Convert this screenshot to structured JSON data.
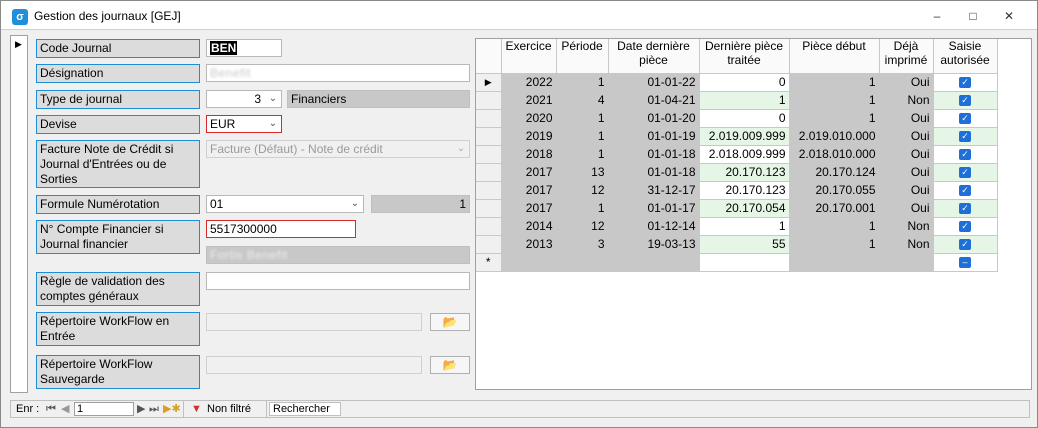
{
  "window": {
    "title": "Gestion des journaux [GEJ]",
    "min": "–",
    "max": "□",
    "close": "✕",
    "icon": "σ"
  },
  "form": {
    "code_journal": {
      "label": "Code  Journal",
      "value": "BEN"
    },
    "designation": {
      "label": "Désignation",
      "value": "Benefit"
    },
    "type_journal": {
      "label": "Type de journal",
      "value": "3",
      "type_label": "Financiers"
    },
    "devise": {
      "label": "Devise",
      "value": "EUR"
    },
    "facture_note": {
      "label": "Facture Note de Crédit si Journal d'Entrées ou de Sorties",
      "value": "Facture (Défaut) - Note de crédit"
    },
    "formule_numerotation": {
      "label": "Formule Numérotation",
      "value": "01",
      "counter": "1"
    },
    "compte_financier": {
      "label": "N° Compte Financier si Journal financier",
      "value": "5517300000",
      "desc": "Fortis Benefit"
    },
    "regle_validation": {
      "label": "Règle de validation des comptes généraux",
      "value": ""
    },
    "workflow_entree": {
      "label": "Répertoire WorkFlow en Entrée",
      "value": ""
    },
    "workflow_sauvegarde": {
      "label": "Répertoire WorkFlow Sauvegarde",
      "value": ""
    }
  },
  "grid": {
    "columns": [
      "Exercice",
      "Période",
      "Date dernière pièce",
      "Dernière pièce traitée",
      "Pièce début",
      "Déjà imprimé",
      "Saisie autorisée"
    ],
    "rows": [
      {
        "exercice": "2022",
        "periode": "1",
        "date": "01-01-22",
        "derniere": "0",
        "debut": "1",
        "imprime": "Oui",
        "current": true
      },
      {
        "exercice": "2021",
        "periode": "4",
        "date": "01-04-21",
        "derniere": "1",
        "debut": "1",
        "imprime": "Non"
      },
      {
        "exercice": "2020",
        "periode": "1",
        "date": "01-01-20",
        "derniere": "0",
        "debut": "1",
        "imprime": "Oui"
      },
      {
        "exercice": "2019",
        "periode": "1",
        "date": "01-01-19",
        "derniere": "2.019.009.999",
        "debut": "2.019.010.000",
        "imprime": "Oui"
      },
      {
        "exercice": "2018",
        "periode": "1",
        "date": "01-01-18",
        "derniere": "2.018.009.999",
        "debut": "2.018.010.000",
        "imprime": "Oui"
      },
      {
        "exercice": "2017",
        "periode": "13",
        "date": "01-01-18",
        "derniere": "20.170.123",
        "debut": "20.170.124",
        "imprime": "Oui"
      },
      {
        "exercice": "2017",
        "periode": "12",
        "date": "31-12-17",
        "derniere": "20.170.123",
        "debut": "20.170.055",
        "imprime": "Oui"
      },
      {
        "exercice": "2017",
        "periode": "1",
        "date": "01-01-17",
        "derniere": "20.170.054",
        "debut": "20.170.001",
        "imprime": "Oui"
      },
      {
        "exercice": "2014",
        "periode": "12",
        "date": "01-12-14",
        "derniere": "1",
        "debut": "1",
        "imprime": "Non"
      },
      {
        "exercice": "2013",
        "periode": "3",
        "date": "19-03-13",
        "derniere": "55",
        "debut": "1",
        "imprime": "Non"
      }
    ],
    "new_row_marker": "*"
  },
  "statusbar": {
    "enr_label": "Enr :",
    "record_value": "1",
    "filter_label": "Non filtré",
    "search_label": "Rechercher"
  }
}
